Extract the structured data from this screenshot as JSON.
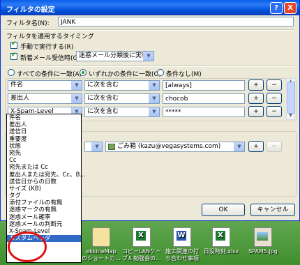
{
  "window": {
    "title": "フィルタの設定",
    "help_glyph": "?",
    "close_glyph": "X"
  },
  "filter_name": {
    "label": "フィルタ名(N):",
    "value": "JANK"
  },
  "timing": {
    "label": "フィルタを適用するタイミング",
    "manual_label": "手動で実行する(R)",
    "manual_checked": true,
    "newmail_label": "新着メール受信時(G):",
    "newmail_checked": true,
    "newmail_option": "迷惑メール分類後に実行"
  },
  "match_mode": {
    "options": [
      {
        "label": "すべての条件に一致(A)",
        "checked": false
      },
      {
        "label": "いずれかの条件に一致(O)",
        "checked": true
      },
      {
        "label": "条件なし(M)",
        "checked": false
      }
    ]
  },
  "conditions": [
    {
      "field": "件名",
      "op": "に次を含む",
      "value": "[always]"
    },
    {
      "field": "差出人",
      "op": "に次を含む",
      "value": "chocob"
    },
    {
      "field": "X-Spam-Level",
      "op": "に次を含む",
      "value": "*****"
    }
  ],
  "row_buttons": {
    "add": "+",
    "remove": "−"
  },
  "action": {
    "target": "ごみ箱 (kazu@vegasystems.com)"
  },
  "dialog_buttons": {
    "ok": "OK",
    "cancel": "キャンセル"
  },
  "field_options": [
    "件名",
    "差出人",
    "送信日",
    "重要度",
    "状態",
    "宛先",
    "Cc",
    "宛先または Cc",
    "差出人または宛先、Cc、B...",
    "送信日からの日数",
    "サイズ (KB)",
    "タグ",
    "添付ファイルの有無",
    "迷惑マークの有無",
    "迷惑メール確率",
    "迷惑メールの判断元",
    "X-Spam-Level",
    "カスタムヘッダ"
  ],
  "selected_field_option": "カスタムヘッダ",
  "desktop_icons": [
    {
      "label": "ekkineMap\nのショートカ...",
      "icon": "shortcut-icon"
    },
    {
      "label": "コピーLANケー\nブル勉強会の...",
      "icon": "excel-file-icon"
    },
    {
      "label": "施工関連の打\nち合わせ事項",
      "icon": "word-file-icon"
    },
    {
      "label": "日没時刻.xlsx",
      "icon": "excel-file-icon"
    },
    {
      "label": "SPAM5.jpg",
      "icon": "image-file-icon"
    }
  ]
}
